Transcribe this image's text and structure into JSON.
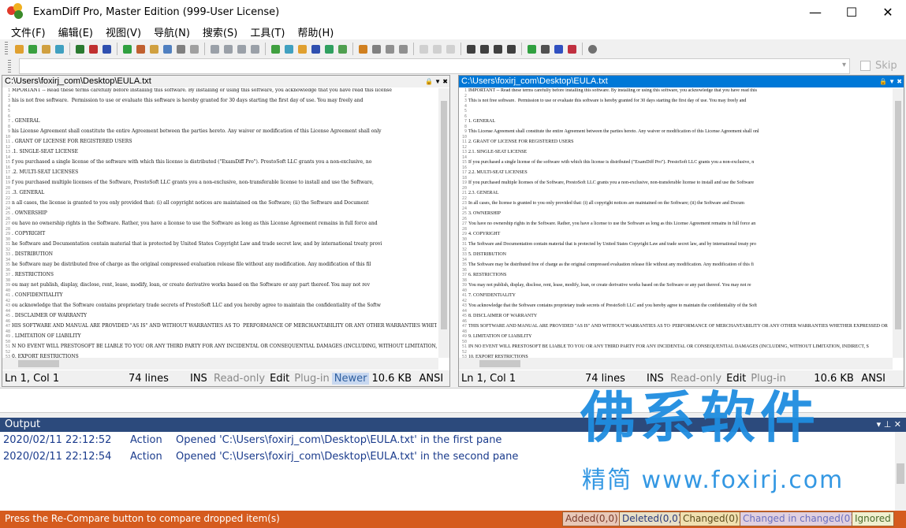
{
  "window": {
    "title": "ExamDiff Pro, Master Edition (999-User License)",
    "minimize": "—",
    "maximize": "☐",
    "close": "✕"
  },
  "menu": [
    "文件(F)",
    "编辑(E)",
    "视图(V)",
    "导航(N)",
    "搜索(S)",
    "工具(T)",
    "帮助(H)"
  ],
  "search": {
    "value": "",
    "skip_label": "Skip"
  },
  "left_pane": {
    "path": "C:\\Users\\foxirj_com\\Desktop\\EULA.txt",
    "lines": [
      "MPORTANT -- Read these terms carefully before installing this software. By installing or using this software, you acknowledge that you have read this license",
      "his is not free software.  Permission to use or evaluate this software is hereby granted for 30 days starting the first day of use. You may freely and",
      "",
      ". GENERAL",
      "his License Agreement shall constitute the entire Agreement between the parties hereto. Any waiver or modification of this License Agreement shall only",
      ". GRANT OF LICENSE FOR REGISTERED USERS",
      ".1. SINGLE-SEAT LICENSE",
      "f you purchased a single license of the software with which this license is distributed (\"ExamDiff Pro\"). PrestoSoft LLC grants you a non-exclusive, no",
      ".2. MULTI-SEAT LICENSES",
      "f you purchased multiple licenses of the Software, PrestoSoft LLC grants you a non-exclusive, non-transferable license to install and use the Software,",
      ".3. GENERAL",
      "n all cases, the license is granted to you only provided that: (i) all copyright notices are maintained on the Software; (ii) the Software and Document",
      ". OWNERSHIP",
      "ou have no ownership rights in the Software. Rather, you have a license to use the Software as long as this License Agreement remains in full force and",
      ". COPYRIGHT",
      "he Software and Documentation contain material that is protected by United States Copyright Law and trade secret law, and by international treaty provi",
      ". DISTRIBUTION",
      "he Software may be distributed free of charge as the original compressed evaluation release file without any modification. Any modification of this fil",
      ". RESTRICTIONS",
      "ou may not publish, display, disclose, rent, lease, modify, loan, or create derivative works based on the Software or any part thereof. You may not rev",
      ". CONFIDENTIALITY",
      "ou acknowledge that the Software contains proprietary trade secrets of PrestoSoft LLC and you hereby agree to maintain the confidentiality of the Softw",
      ". DISCLAIMER OF WARRANTY",
      "HIS SOFTWARE AND MANUAL ARE PROVIDED \"AS IS\" AND WITHOUT WARRANTIES AS TO  PERFORMANCE OF MERCHANTABILITY OR ANY OTHER WARRANTIES WHETHER EXPRESSED OR",
      ". LIMITATION OF LIABILITY",
      "N NO EVENT WILL PRESTOSOFT BE LIABLE TO YOU OR ANY THIRD PARTY FOR ANY INCIDENTAL OR CONSEQUENTIAL DAMAGES (INCLUDING, WITHOUT LIMITATION, INDIRECT, SP",
      "0. EXPORT RESTRICTIONS"
    ],
    "status": {
      "pos": "Ln 1, Col 1",
      "lines": "74 lines",
      "ins": "INS",
      "readonly": "Read-only",
      "edit": "Edit",
      "plugin": "Plug-in",
      "newer": "Newer",
      "size": "10.6 KB",
      "enc": "ANSI"
    }
  },
  "right_pane": {
    "path": "C:\\Users\\foxirj_com\\Desktop\\EULA.txt",
    "lines": [
      "IMPORTANT -- Read these terms carefully before installing this software. By installing or using this software, you acknowledge that you have read this",
      "This is not free software.  Permission to use or evaluate this software is hereby granted for 30 days starting the first day of use. You may freely and",
      "",
      "1. GENERAL",
      "This License Agreement shall constitute the entire Agreement between the parties hereto. Any waiver or modification of this License Agreement shall onl",
      "2. GRANT OF LICENSE FOR REGISTERED USERS",
      "2.1. SINGLE-SEAT LICENSE",
      "If you purchased a single license of the software with which this license is distributed (\"ExamDiff Pro\"). PrestoSoft LLC grants you a non-exclusive, n",
      "2.2. MULTI-SEAT LICENSES",
      "If you purchased multiple licenses of the Software, PrestoSoft LLC grants you a non-exclusive, non-transferable license to install and use the Software",
      "2.3. GENERAL",
      "In all cases, the license is granted to you only provided that: (i) all copyright notices are maintained on the Software; (ii) the Software and Docum",
      "3. OWNERSHIP",
      "You have no ownership rights in the Software. Rather, you have a license to use the Software as long as this License Agreement remains in full force an",
      "4. COPYRIGHT",
      "The Software and Documentation contain material that is protected by United States Copyright Law and trade secret law, and by international treaty pro",
      "5. DISTRIBUTION",
      "The Software may be distributed free of charge as the original compressed evaluation release file without any modification. Any modification of this fi",
      "6. RESTRICTIONS",
      "You may not publish, display, disclose, rent, lease, modify, loan, or create derivative works based on the Software or any part thereof. You may not re",
      "7. CONFIDENTIALITY",
      "You acknowledge that the Software contains proprietary trade secrets of PrestoSoft LLC and you hereby agree to maintain the confidentiality of the Soft",
      "8. DISCLAIMER OF WARRANTY",
      "THIS SOFTWARE AND MANUAL ARE PROVIDED \"AS IS\" AND WITHOUT WARRANTIES AS TO  PERFORMANCE OF MERCHANTABILITY OR ANY OTHER WARRANTIES WHETHER EXPRESSED OR",
      "9. LIMITATION OF LIABILITY",
      "IN NO EVENT WILL PRESTOSOFT BE LIABLE TO YOU OR ANY THIRD PARTY FOR ANY INCIDENTAL OR CONSEQUENTIAL DAMAGES (INCLUDING, WITHOUT LIMITATION, INDIRECT, S",
      "10. EXPORT RESTRICTIONS"
    ],
    "status": {
      "pos": "Ln 1, Col 1",
      "lines": "74 lines",
      "ins": "INS",
      "readonly": "Read-only",
      "edit": "Edit",
      "plugin": "Plug-in",
      "size": "10.6 KB",
      "enc": "ANSI"
    }
  },
  "output": {
    "title": "Output",
    "rows": [
      {
        "time": "2020/02/11 22:12:52",
        "kind": "Action",
        "msg": "Opened 'C:\\Users\\foxirj_com\\Desktop\\EULA.txt' in the first pane"
      },
      {
        "time": "2020/02/11 22:12:54",
        "kind": "Action",
        "msg": "Opened 'C:\\Users\\foxirj_com\\Desktop\\EULA.txt' in the second pane"
      }
    ]
  },
  "statusbar": {
    "message": "Press the Re-Compare button to compare dropped item(s)",
    "added": "Added(0,0)",
    "deleted": "Deleted(0,0)",
    "changed": "Changed(0)",
    "changed_in_changed": "Changed in changed(0)",
    "ignored": "Ignored"
  },
  "watermark": {
    "main": "佛系软件",
    "sub": "精简 www.foxirj.com"
  },
  "colors": {
    "accent_blue": "#0078d7",
    "output_header": "#2c4a7c",
    "statusbar": "#d55b1e",
    "newer": "#c8d8f0",
    "added": "#e8c8b8",
    "deleted": "#e8e0c8",
    "changed": "#f0e0b0",
    "changed_in_changed": "#e0d0e0",
    "ignored": "#f0f0d0"
  }
}
